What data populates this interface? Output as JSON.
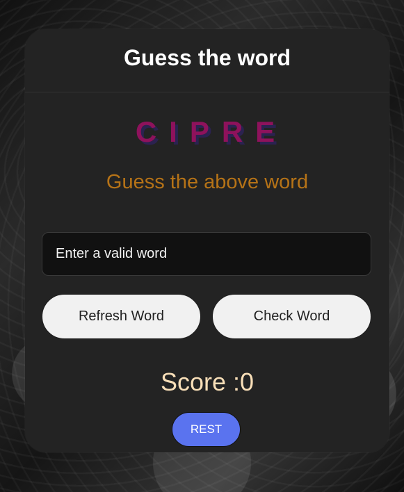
{
  "game": {
    "title": "Guess the word",
    "scrambled_word": "CIPRE",
    "hint": "Guess the above word",
    "input": {
      "value": "",
      "placeholder": "Enter a valid word"
    },
    "buttons": {
      "refresh": "Refresh Word",
      "check": "Check Word",
      "reset": "REST"
    },
    "score_text": "Score :0"
  },
  "colors": {
    "card_background": "#232323",
    "title": "#ffffff",
    "scrambled_word": "#8e125c",
    "hint": "#b67317",
    "score": "#f9dfb8",
    "reset_button": "#5a73ef",
    "secondary_buttons": "#f1f1f1"
  }
}
